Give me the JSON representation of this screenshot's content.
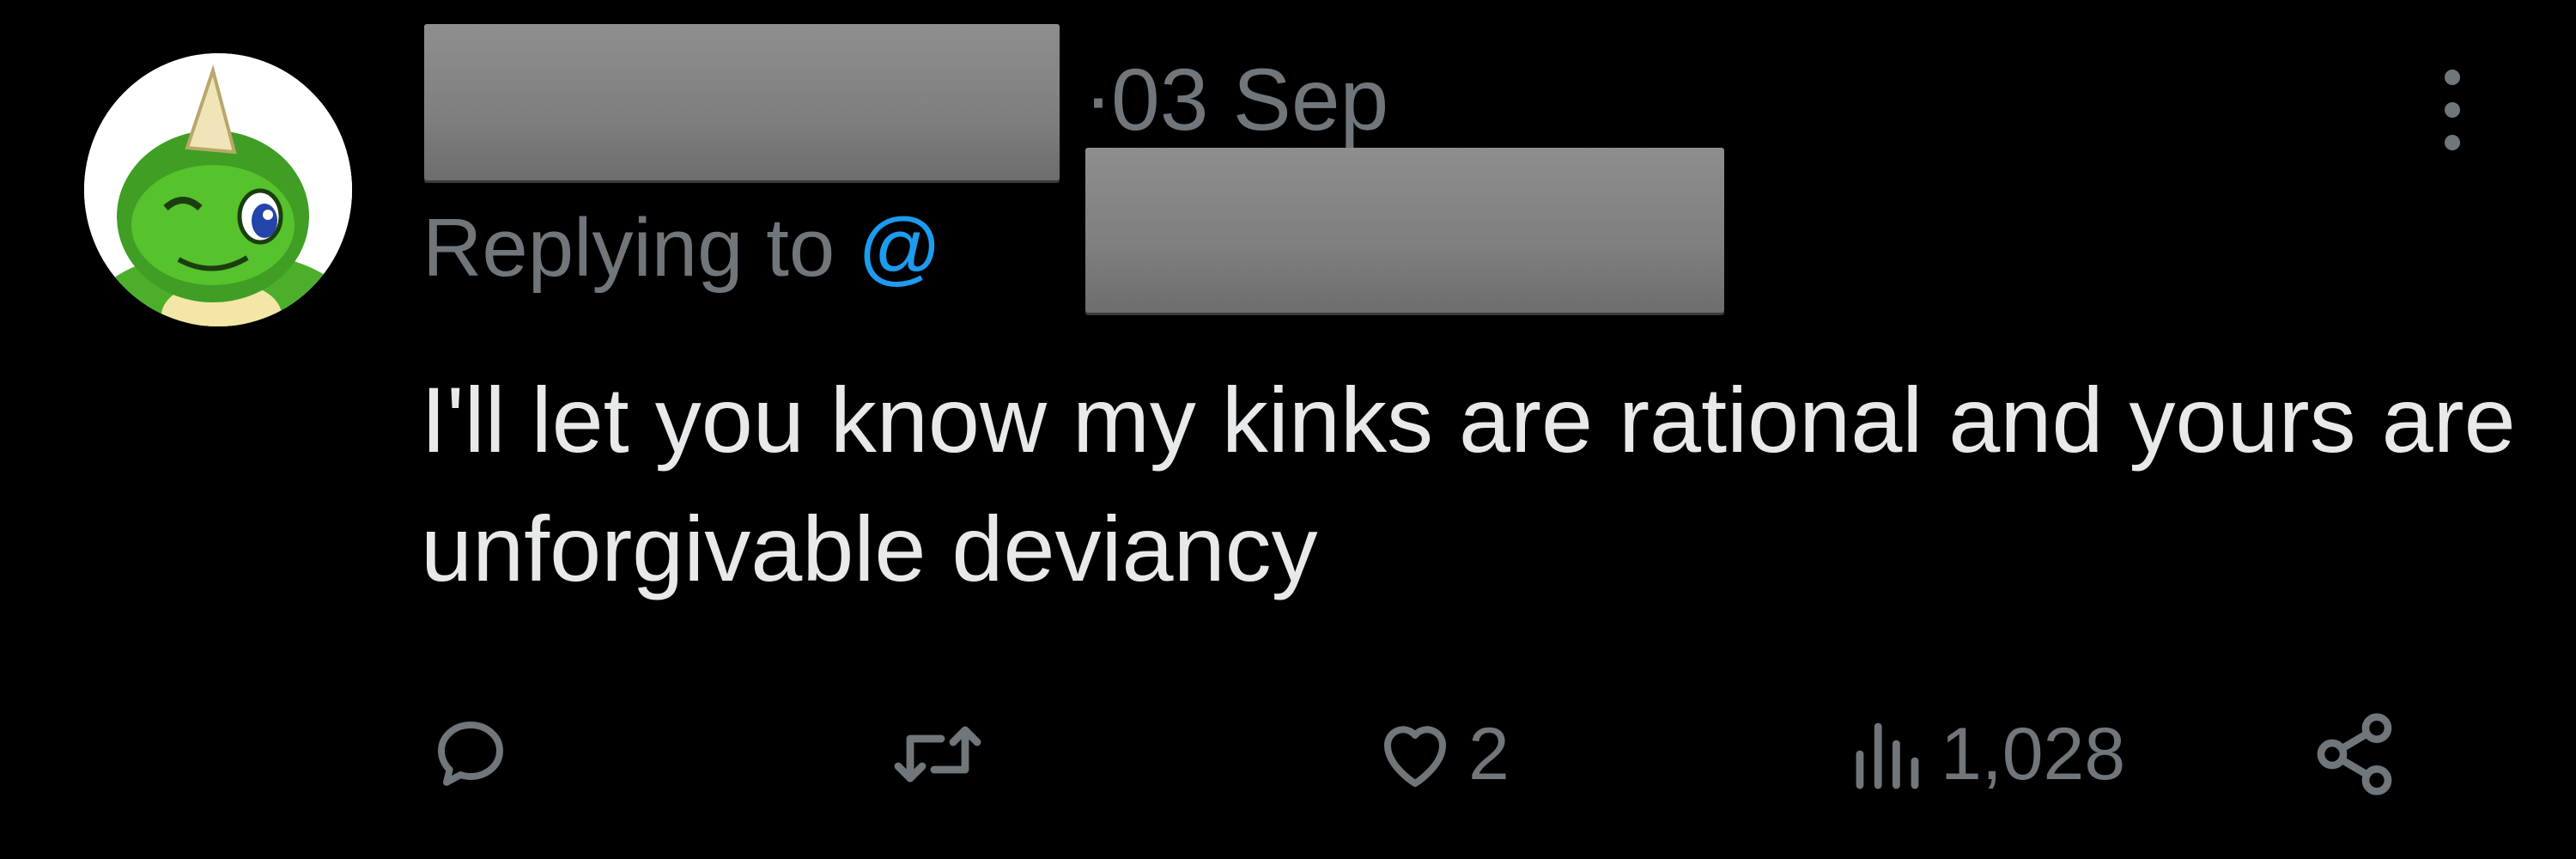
{
  "tweet": {
    "author_name": "",
    "separator": "·",
    "date": "03 Sep",
    "replying_prefix": "Replying to ",
    "replying_at": "@",
    "text": "I'll let you know my kinks are rational and yours are unforgivable deviancy"
  },
  "actions": {
    "reply_count": "",
    "retweet_count": "",
    "like_count": "2",
    "view_count": "1,028"
  },
  "icons": {
    "reply": "reply-icon",
    "retweet": "retweet-icon",
    "like": "heart-icon",
    "views": "views-icon",
    "share": "share-icon",
    "more": "more-icon"
  },
  "colors": {
    "background": "#000000",
    "text_primary": "#e7e9ea",
    "text_secondary": "#71767b",
    "accent": "#1d9bf0",
    "redaction": "#808080"
  }
}
